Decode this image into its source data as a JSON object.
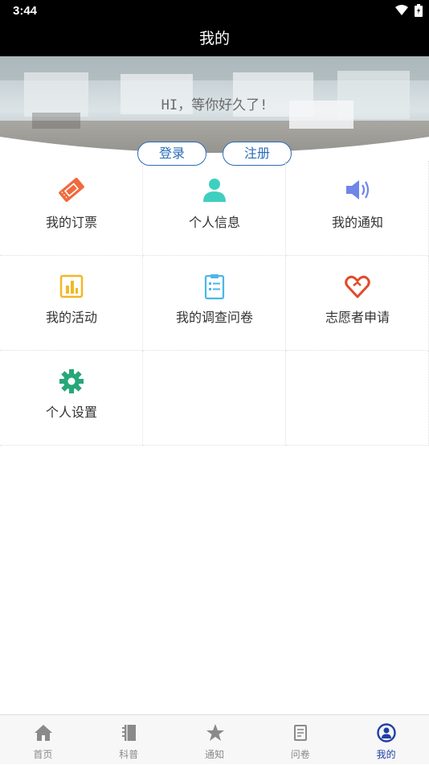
{
  "status": {
    "time": "3:44"
  },
  "header": {
    "title": "我的"
  },
  "banner": {
    "greeting": "HI，等你好久了!"
  },
  "auth": {
    "login_label": "登录",
    "register_label": "注册"
  },
  "menu": {
    "items": [
      {
        "label": "我的订票",
        "icon": "ticket-icon",
        "color": "#f06a3c"
      },
      {
        "label": "个人信息",
        "icon": "person-icon",
        "color": "#3fcfbf"
      },
      {
        "label": "我的通知",
        "icon": "speaker-icon",
        "color": "#6e86e8"
      },
      {
        "label": "我的活动",
        "icon": "chart-icon",
        "color": "#f2b824"
      },
      {
        "label": "我的调查问卷",
        "icon": "clipboard-icon",
        "color": "#4bb6e8"
      },
      {
        "label": "志愿者申请",
        "icon": "heart-icon",
        "color": "#e24a2a"
      },
      {
        "label": "个人设置",
        "icon": "gear-icon",
        "color": "#27a77a"
      }
    ]
  },
  "tabs": [
    {
      "label": "首页",
      "icon": "home-icon"
    },
    {
      "label": "科普",
      "icon": "book-icon"
    },
    {
      "label": "通知",
      "icon": "star-icon"
    },
    {
      "label": "问卷",
      "icon": "document-icon"
    },
    {
      "label": "我的",
      "icon": "user-circle-icon",
      "active": true
    }
  ]
}
